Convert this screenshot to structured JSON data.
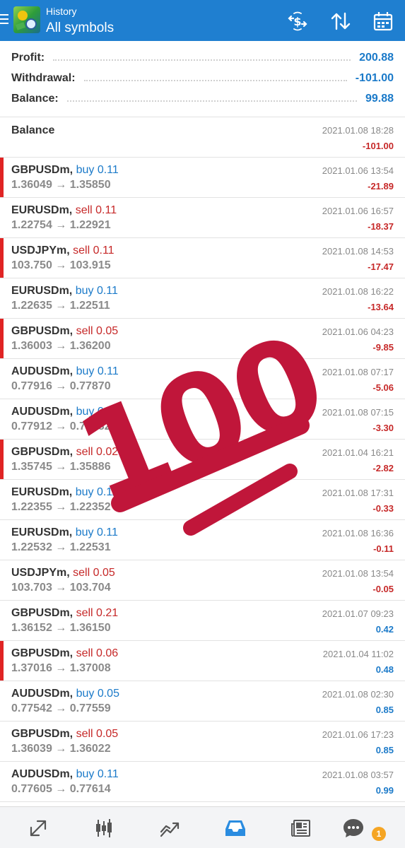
{
  "header": {
    "subtitle": "History",
    "title": "All symbols",
    "icons": [
      "menu-icon",
      "currency-exchange-icon",
      "sort-icon",
      "calendar-icon"
    ]
  },
  "summary": {
    "profit_label": "Profit:",
    "profit_value": "200.88",
    "withdrawal_label": "Withdrawal:",
    "withdrawal_value": "-101.00",
    "balance_label": "Balance:",
    "balance_value": "99.88"
  },
  "balance_entry": {
    "label": "Balance",
    "time": "2021.01.08 18:28",
    "amount": "-101.00"
  },
  "trades": [
    {
      "symbol": "GBPUSDm,",
      "side": "buy",
      "volume": "0.11",
      "open": "1.36049",
      "close": "1.35850",
      "time": "2021.01.06 13:54",
      "profit": "-21.89",
      "marker": true
    },
    {
      "symbol": "EURUSDm,",
      "side": "sell",
      "volume": "0.11",
      "open": "1.22754",
      "close": "1.22921",
      "time": "2021.01.06 16:57",
      "profit": "-18.37",
      "marker": false
    },
    {
      "symbol": "USDJPYm,",
      "side": "sell",
      "volume": "0.11",
      "open": "103.750",
      "close": "103.915",
      "time": "2021.01.08 14:53",
      "profit": "-17.47",
      "marker": true
    },
    {
      "symbol": "EURUSDm,",
      "side": "buy",
      "volume": "0.11",
      "open": "1.22635",
      "close": "1.22511",
      "time": "2021.01.08 16:22",
      "profit": "-13.64",
      "marker": false
    },
    {
      "symbol": "GBPUSDm,",
      "side": "sell",
      "volume": "0.05",
      "open": "1.36003",
      "close": "1.36200",
      "time": "2021.01.06 04:23",
      "profit": "-9.85",
      "marker": true
    },
    {
      "symbol": "AUDUSDm,",
      "side": "buy",
      "volume": "0.11",
      "open": "0.77916",
      "close": "0.77870",
      "time": "2021.01.08 07:17",
      "profit": "-5.06",
      "marker": false
    },
    {
      "symbol": "AUDUSDm,",
      "side": "buy",
      "volume": "0.11",
      "open": "0.77912",
      "close": "0.77882",
      "time": "2021.01.08 07:15",
      "profit": "-3.30",
      "marker": false
    },
    {
      "symbol": "GBPUSDm,",
      "side": "sell",
      "volume": "0.02",
      "open": "1.35745",
      "close": "1.35886",
      "time": "2021.01.04 16:21",
      "profit": "-2.82",
      "marker": true
    },
    {
      "symbol": "EURUSDm,",
      "side": "buy",
      "volume": "0.11",
      "open": "1.22355",
      "close": "1.22352",
      "time": "2021.01.08 17:31",
      "profit": "-0.33",
      "marker": false
    },
    {
      "symbol": "EURUSDm,",
      "side": "buy",
      "volume": "0.11",
      "open": "1.22532",
      "close": "1.22531",
      "time": "2021.01.08 16:36",
      "profit": "-0.11",
      "marker": false
    },
    {
      "symbol": "USDJPYm,",
      "side": "sell",
      "volume": "0.05",
      "open": "103.703",
      "close": "103.704",
      "time": "2021.01.08 13:54",
      "profit": "-0.05",
      "marker": false
    },
    {
      "symbol": "GBPUSDm,",
      "side": "sell",
      "volume": "0.21",
      "open": "1.36152",
      "close": "1.36150",
      "time": "2021.01.07 09:23",
      "profit": "0.42",
      "marker": false
    },
    {
      "symbol": "GBPUSDm,",
      "side": "sell",
      "volume": "0.06",
      "open": "1.37016",
      "close": "1.37008",
      "time": "2021.01.04 11:02",
      "profit": "0.48",
      "marker": true
    },
    {
      "symbol": "AUDUSDm,",
      "side": "buy",
      "volume": "0.05",
      "open": "0.77542",
      "close": "0.77559",
      "time": "2021.01.08 02:30",
      "profit": "0.85",
      "marker": false
    },
    {
      "symbol": "GBPUSDm,",
      "side": "sell",
      "volume": "0.05",
      "open": "1.36039",
      "close": "1.36022",
      "time": "2021.01.06 17:23",
      "profit": "0.85",
      "marker": false
    },
    {
      "symbol": "AUDUSDm,",
      "side": "buy",
      "volume": "0.11",
      "open": "0.77605",
      "close": "0.77614",
      "time": "2021.01.08 03:57",
      "profit": "0.99",
      "marker": false
    }
  ],
  "arrow": "→",
  "sticker": {
    "text": "100",
    "icon": "hundred-points-emoji-icon",
    "color": "#c0163a"
  },
  "bottom_nav": {
    "items": [
      "quotes-icon",
      "chart-candles-icon",
      "trade-icon",
      "history-icon",
      "news-icon",
      "chat-icon"
    ],
    "active": "history-icon",
    "chat_badge": "1"
  },
  "colors": {
    "accent": "#1f7fd0",
    "negative": "#c62828",
    "positive": "#1b7ac9",
    "marker": "#e02424",
    "badge": "#f5a524"
  }
}
